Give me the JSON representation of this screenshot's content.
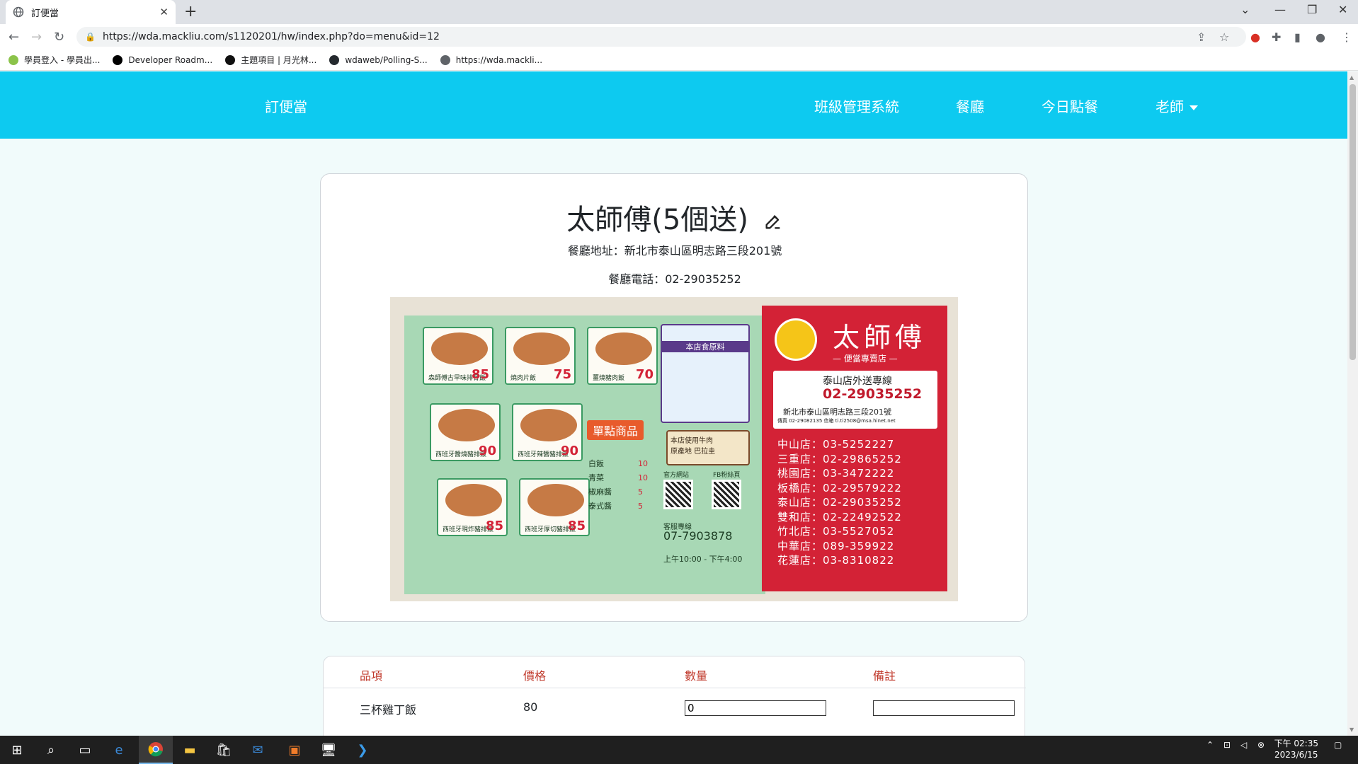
{
  "browser": {
    "tab_title": "訂便當",
    "url": "https://wda.mackliu.com/s1120201/hw/index.php?do=menu&id=12",
    "bookmarks": [
      {
        "label": "學員登入 - 學員出...",
        "color": "#8bc34a"
      },
      {
        "label": "Developer Roadm...",
        "color": "#000000"
      },
      {
        "label": "主題項目 | 月光林...",
        "color": "#111111"
      },
      {
        "label": "wdaweb/Polling-S...",
        "color": "#24292e"
      },
      {
        "label": "https://wda.mackli...",
        "color": "#5f6368"
      }
    ]
  },
  "navbar": {
    "brand": "訂便當",
    "links": [
      "班級管理系統",
      "餐廳",
      "今日點餐"
    ],
    "dropdown": "老師",
    "bg_color": "#0dcaf0"
  },
  "restaurant": {
    "name": "太師傅(5個送)",
    "address": "餐廳地址：新北市泰山區明志路三段201號",
    "phone": "餐廳電話：02-29035252"
  },
  "menu_photo": {
    "brand": "太師傅",
    "subtitle": "— 便當專賣店 —",
    "hotline_label": "泰山店外送專線",
    "hotline": "02-29035252",
    "address": "新北市泰山區明志路三段201號",
    "fax": "傳真 02-29082135 信箱 ti.ti2508@msa.hinet.net",
    "single_items": "單點商品",
    "ingredient_title": "本店食原料",
    "beef_note": "本店使用牛肉",
    "beef_origin": "原產地 巴拉圭",
    "service_label": "客服專線",
    "service_phone": "07-7903878",
    "hours": "上午10:00 - 下午4:00",
    "official_site": "官方網站",
    "fb": "FB粉絲頁",
    "sides": [
      "白飯",
      "青菜",
      "椒麻醬",
      "泰式醬"
    ],
    "side_prices": [
      "10",
      "10",
      "5",
      "5"
    ],
    "dishes": [
      {
        "name": "森師傅古早味排骨飯",
        "price": "85"
      },
      {
        "name": "燒肉片飯",
        "price": "75"
      },
      {
        "name": "薑燒豬肉飯",
        "price": "70"
      },
      {
        "name": "西班牙醬燒豬排飯",
        "price": "90"
      },
      {
        "name": "西班牙辣醬豬排飯",
        "price": "90"
      },
      {
        "name": "西班牙現炸豬排飯",
        "price": "85"
      },
      {
        "name": "西班牙厚切豬排飯",
        "price": "85"
      }
    ],
    "branches": [
      "中山店：03-5252227",
      "三重店：02-29865252",
      "桃園店：03-3472222",
      "板橋店：02-29579222",
      "泰山店：02-29035252",
      "雙和店：02-22492522",
      "竹北店：03-5527052",
      "中華店：089-359922",
      "花蓮店：03-8310822"
    ]
  },
  "order_table": {
    "headers": [
      "品項",
      "價格",
      "數量",
      "備註"
    ],
    "rows": [
      {
        "item": "三杯雞丁飯",
        "price": "80",
        "qty": "0",
        "note": ""
      }
    ]
  },
  "taskbar": {
    "time": "下午 02:35",
    "date": "2023/6/15"
  }
}
